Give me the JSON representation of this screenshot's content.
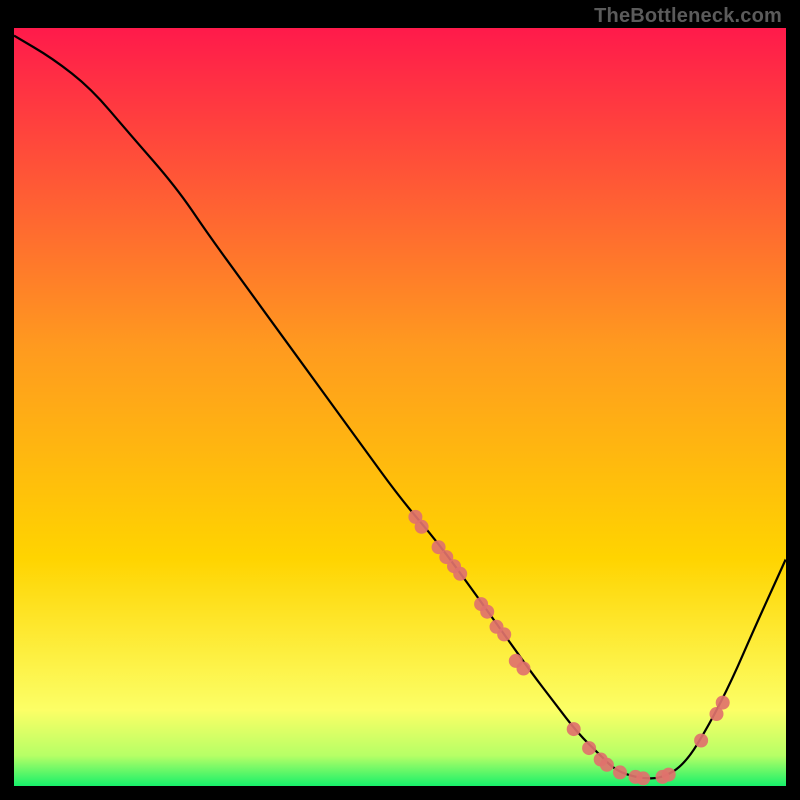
{
  "watermark": "TheBottleneck.com",
  "chart_data": {
    "type": "line",
    "title": "",
    "xlabel": "",
    "ylabel": "",
    "xlim": [
      0,
      100
    ],
    "ylim": [
      0,
      100
    ],
    "curve": {
      "x": [
        0,
        5,
        10,
        15,
        21,
        25,
        30,
        35,
        40,
        45,
        50,
        55,
        60,
        63.5,
        67,
        70,
        73,
        76,
        78,
        81,
        84,
        87,
        90,
        93,
        96,
        100
      ],
      "y": [
        99,
        96,
        92,
        86,
        79,
        73,
        66,
        59,
        52,
        45,
        38,
        32,
        25,
        20,
        15,
        11,
        7,
        4,
        2,
        1,
        1,
        3,
        8,
        14,
        21,
        30
      ]
    },
    "dots": [
      {
        "x": 52.0,
        "y": 35.5
      },
      {
        "x": 52.8,
        "y": 34.2
      },
      {
        "x": 55.0,
        "y": 31.5
      },
      {
        "x": 56.0,
        "y": 30.2
      },
      {
        "x": 57.0,
        "y": 29.0
      },
      {
        "x": 57.8,
        "y": 28.0
      },
      {
        "x": 60.5,
        "y": 24.0
      },
      {
        "x": 61.3,
        "y": 23.0
      },
      {
        "x": 62.5,
        "y": 21.0
      },
      {
        "x": 63.5,
        "y": 20.0
      },
      {
        "x": 65.0,
        "y": 16.5
      },
      {
        "x": 66.0,
        "y": 15.5
      },
      {
        "x": 72.5,
        "y": 7.5
      },
      {
        "x": 74.5,
        "y": 5.0
      },
      {
        "x": 76.0,
        "y": 3.5
      },
      {
        "x": 76.8,
        "y": 2.8
      },
      {
        "x": 78.5,
        "y": 1.8
      },
      {
        "x": 80.5,
        "y": 1.2
      },
      {
        "x": 81.5,
        "y": 1.0
      },
      {
        "x": 84.0,
        "y": 1.2
      },
      {
        "x": 84.8,
        "y": 1.5
      },
      {
        "x": 89.0,
        "y": 6.0
      },
      {
        "x": 91.0,
        "y": 9.5
      },
      {
        "x": 91.8,
        "y": 11.0
      }
    ],
    "colors": {
      "gradient_top": "#ff1a4b",
      "gradient_mid": "#ffd400",
      "gradient_bot_yellow": "#fcff66",
      "gradient_green": "#17f06a",
      "curve": "#000000",
      "dot": "#e0726c"
    }
  }
}
